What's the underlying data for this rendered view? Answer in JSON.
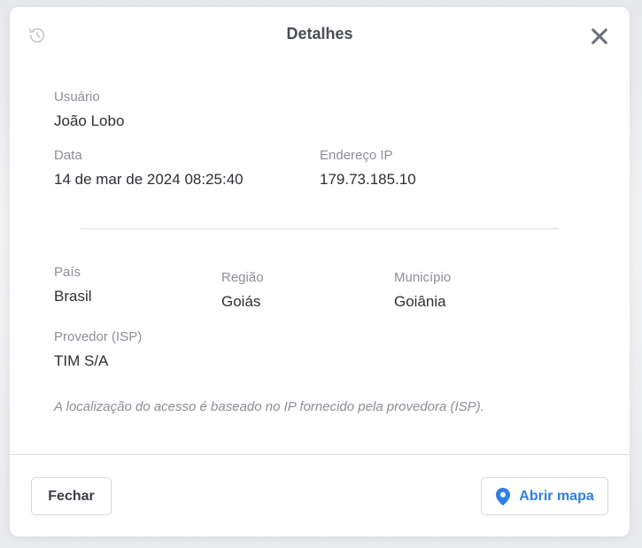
{
  "modal": {
    "title": "Detalhes",
    "icons": {
      "history": "history-icon",
      "close": "close-icon",
      "map_pin": "map-pin-icon"
    }
  },
  "details": {
    "user": {
      "label": "Usuário",
      "value": "João Lobo"
    },
    "date": {
      "label": "Data",
      "value": "14 de mar de 2024 08:25:40"
    },
    "ip": {
      "label": "Endereço IP",
      "value": "179.73.185.10"
    },
    "country": {
      "label": "País",
      "value": "Brasil"
    },
    "region": {
      "label": "Região",
      "value": "Goiás"
    },
    "city": {
      "label": "Município",
      "value": "Goiânia"
    },
    "isp": {
      "label": "Provedor (ISP)",
      "value": "TIM S/A"
    }
  },
  "note": "A localização do acesso é baseado no IP fornecido pela provedora (ISP).",
  "footer": {
    "close_label": "Fechar",
    "map_label": "Abrir mapa"
  },
  "colors": {
    "accent": "#2f7fe4",
    "title": "#4a4d55",
    "label": "#8b8e96",
    "value": "#2d2f34"
  }
}
